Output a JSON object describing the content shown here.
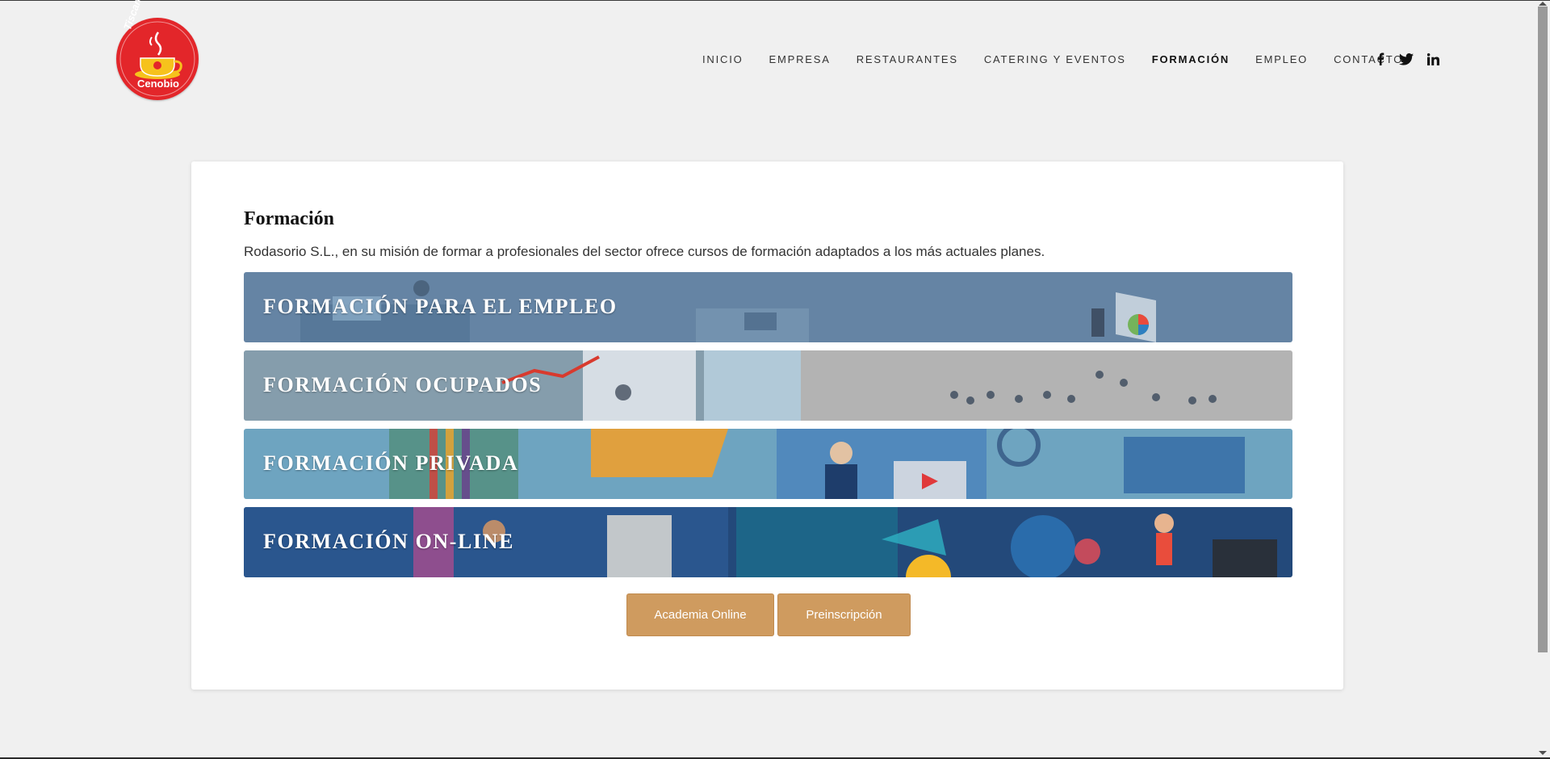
{
  "logo": {
    "text_top": "Tiscamanita",
    "text_bottom": "Cenobio"
  },
  "nav": {
    "items": [
      "INICIO",
      "EMPRESA",
      "RESTAURANTES",
      "CATERING Y EVENTOS",
      "FORMACIÓN",
      "EMPLEO",
      "CONTACTO"
    ],
    "active": "FORMACIÓN",
    "social": [
      "facebook-icon",
      "twitter-icon",
      "linkedin-icon"
    ]
  },
  "main": {
    "title": "Formación",
    "intro": "Rodasorio S.L., en su misión de formar a profesionales del sector ofrece cursos de formación adaptados a los más actuales planes.",
    "banners": [
      {
        "label": "FORMACIÓN PARA EL EMPLEO",
        "color": "#6584a4"
      },
      {
        "label": "FORMACIÓN OCUPADOS",
        "color": "#b3b3b3"
      },
      {
        "label": "FORMACIÓN PRIVADA",
        "color": "#6ea4c0"
      },
      {
        "label": "FORMACIÓN ON-LINE",
        "color": "#23497a"
      }
    ],
    "buttons": {
      "academia": "Academia Online",
      "preinscripcion": "Preinscripción"
    }
  },
  "colors": {
    "accent": "#cf9b5f",
    "logo_red": "#e3262a",
    "background": "#f0f0f0"
  }
}
